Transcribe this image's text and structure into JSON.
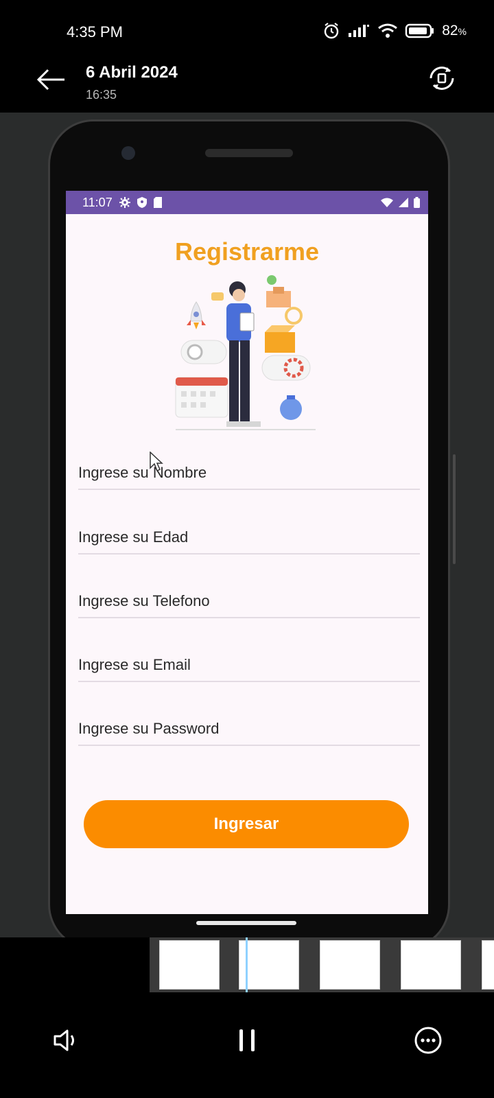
{
  "os_status": {
    "time": "4:35 PM",
    "battery": "82",
    "battery_unit": "%"
  },
  "viewer": {
    "title": "6 Abril 2024",
    "subtitle": "16:35"
  },
  "emulator": {
    "status_time": "11:07",
    "heading": "Registrarme",
    "fields": [
      {
        "placeholder": "Ingrese su Nombre"
      },
      {
        "placeholder": "Ingrese su Edad"
      },
      {
        "placeholder": "Ingrese su Telefono"
      },
      {
        "placeholder": "Ingrese su Email"
      },
      {
        "placeholder": "Ingrese su Password"
      }
    ],
    "submit_label": "Ingresar"
  },
  "colors": {
    "accent_orange": "#fb8c00",
    "title_orange": "#f0a020",
    "emulator_status_purple": "#6c52a8"
  },
  "icons": [
    "back-arrow-icon",
    "rotate-icon",
    "alarm-icon",
    "signal-icon",
    "wifi-icon",
    "battery-icon",
    "volume-icon",
    "pause-icon",
    "more-icon"
  ]
}
